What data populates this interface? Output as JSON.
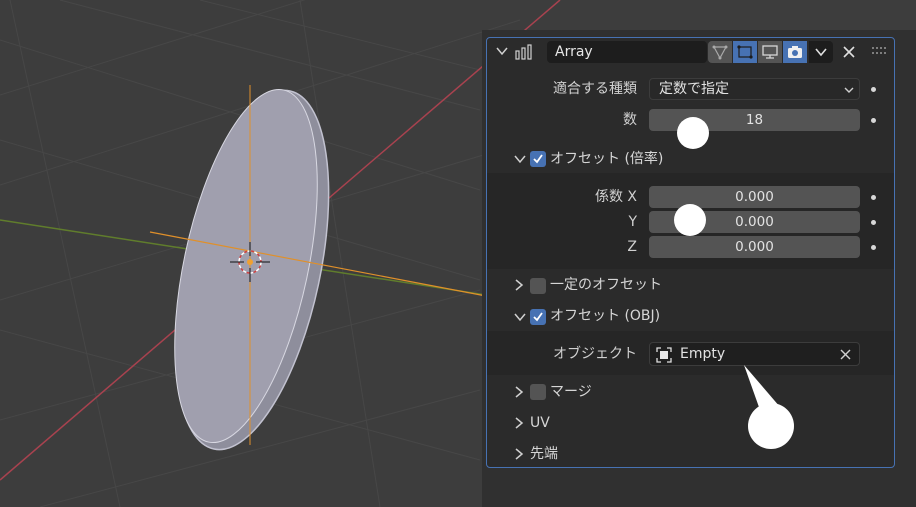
{
  "modifier": {
    "name": "Array",
    "icons": {
      "header_collapse": "chevron-down-icon",
      "modifier_type": "array-modifier-icon",
      "editmode": "edit-mode-vertex-icon",
      "cage": "on-cage-icon",
      "viewport": "monitor-icon",
      "render": "camera-icon",
      "menu": "chevron-down-icon",
      "close": "close-icon",
      "drag": "drag-grip-icon"
    }
  },
  "fit_type": {
    "label": "適合する種類",
    "value": "定数で指定"
  },
  "count": {
    "label": "数",
    "value": "18"
  },
  "relative_offset": {
    "label": "オフセット (倍率)",
    "checked": true,
    "x_label": "係数 X",
    "y_label": "Y",
    "z_label": "Z",
    "x": "0.000",
    "y": "0.000",
    "z": "0.000"
  },
  "constant_offset": {
    "label": "一定のオフセット",
    "checked": false
  },
  "object_offset": {
    "label": "オフセット (OBJ)",
    "checked": true,
    "object_label": "オブジェクト",
    "object_value": "Empty"
  },
  "merge": {
    "label": "マージ",
    "checked": false
  },
  "uv": {
    "label": "UV"
  },
  "caps": {
    "label": "先端"
  },
  "colors": {
    "accent": "#4772b3",
    "viewport_bg": "#3d3d3d",
    "x_axis": "#b34a5a",
    "y_axis": "#6f8f3a",
    "origin": "#f0a030"
  }
}
